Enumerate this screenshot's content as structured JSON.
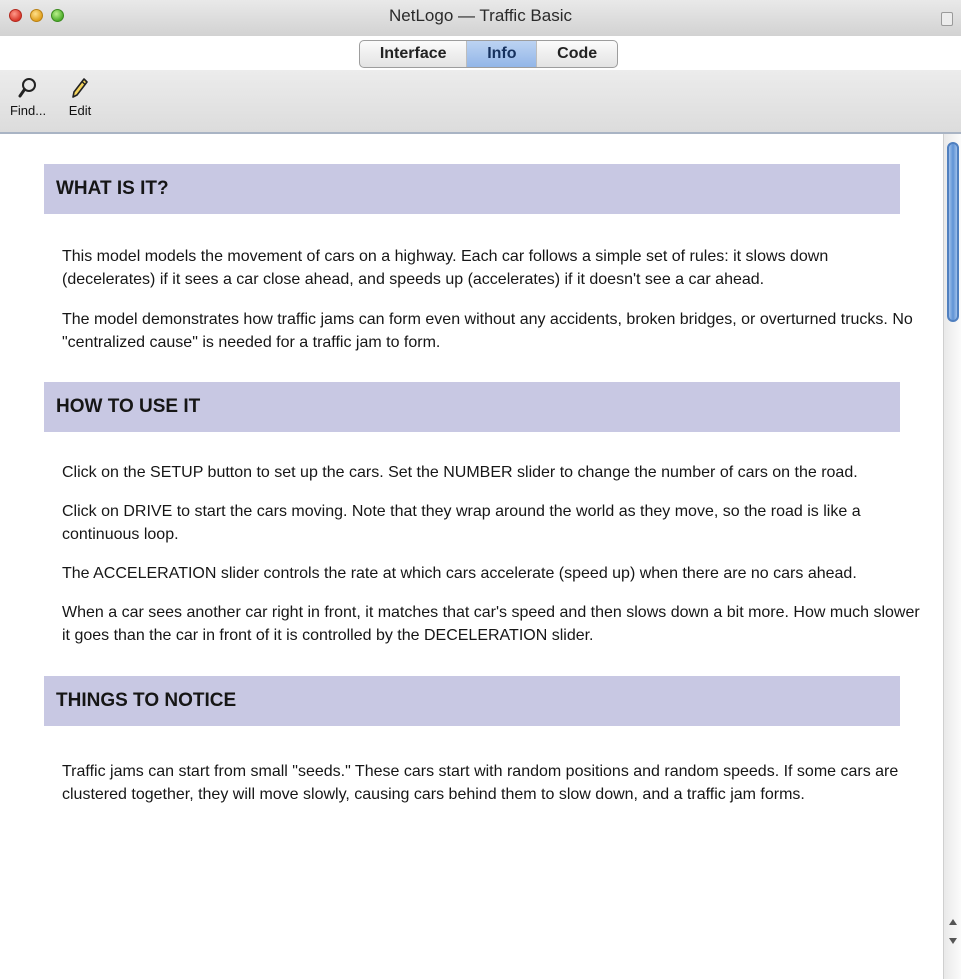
{
  "window": {
    "title": "NetLogo — Traffic Basic"
  },
  "tabs": [
    {
      "label": "Interface",
      "active": false
    },
    {
      "label": "Info",
      "active": true
    },
    {
      "label": "Code",
      "active": false
    }
  ],
  "toolbar": {
    "find_label": "Find...",
    "find_icon": "magnifier-icon",
    "edit_label": "Edit",
    "edit_icon": "pencil-icon"
  },
  "sections": [
    {
      "heading": "WHAT IS IT?",
      "paragraphs": [
        "This model models the movement of cars on a highway. Each car follows a simple set of rules: it slows down (decelerates) if it sees a car close ahead, and speeds up (accelerates) if it doesn't see a car ahead.",
        "The model demonstrates how traffic jams can form even without any accidents, broken bridges, or overturned trucks. No \"centralized cause\" is needed for a traffic jam to form."
      ]
    },
    {
      "heading": "HOW TO USE IT",
      "paragraphs": [
        "Click on the SETUP button to set up the cars. Set the NUMBER slider to change the number of cars on the road.",
        "Click on DRIVE to start the cars moving. Note that they wrap around the world as they move, so the road is like a continuous loop.",
        "The ACCELERATION slider controls the rate at which cars accelerate (speed up) when there are no cars ahead.",
        "When a car sees another car right in front, it matches that car's speed and then slows down a bit more. How much slower it goes than the car in front of it is controlled by the DECELERATION slider."
      ]
    },
    {
      "heading": "THINGS TO NOTICE",
      "paragraphs": [
        "Traffic jams can start from small \"seeds.\" These cars start with random positions and random speeds. If some cars are clustered together, they will move slowly, causing cars behind them to slow down, and a traffic jam forms."
      ]
    }
  ],
  "colors": {
    "section_heading_bg": "#c8c8e3",
    "active_tab": "#93b6e8"
  }
}
